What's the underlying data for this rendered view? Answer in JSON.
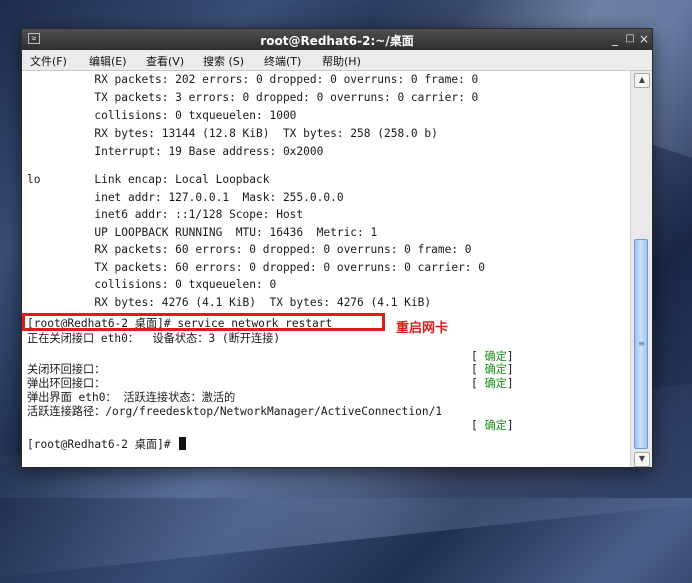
{
  "window": {
    "title": "root@Redhat6-2:~/桌面",
    "icon_glyph": "≥",
    "controls": {
      "minimize": "_",
      "maximize": "□",
      "close": "×"
    }
  },
  "menu": [
    {
      "label": "文件(F)"
    },
    {
      "label": "编辑(E)"
    },
    {
      "label": "查看(V)"
    },
    {
      "label": "搜索 (S)"
    },
    {
      "label": "终端(T)"
    },
    {
      "label": "帮助(H)"
    }
  ],
  "terminal": {
    "lines": [
      "          RX packets: 202 errors: 0 dropped: 0 overruns: 0 frame: 0",
      "          TX packets: 3 errors: 0 dropped: 0 overruns: 0 carrier: 0",
      "          collisions: 0 txqueuelen: 1000",
      "          RX bytes: 13144 (12.8 KiB)  TX bytes: 258 (258.0 b)",
      "          Interrupt: 19 Base address: 0x2000",
      "",
      "lo        Link encap: Local Loopback",
      "          inet addr: 127.0.0.1  Mask: 255.0.0.0",
      "          inet6 addr: ::1/128 Scope: Host",
      "          UP LOOPBACK RUNNING  MTU: 16436  Metric: 1",
      "          RX packets: 60 errors: 0 dropped: 0 overruns: 0 frame: 0",
      "          TX packets: 60 errors: 0 dropped: 0 overruns: 0 carrier: 0",
      "          collisions: 0 txqueuelen: 0",
      "          RX bytes: 4276 (4.1 KiB)  TX bytes: 4276 (4.1 KiB)",
      "",
      "[root@Redhat6-2 桌面]# service network restart",
      "正在关闭接口 eth0：  设备状态：3 (断开连接)",
      "",
      "关闭环回接口：",
      "弹出环回接口：",
      "弹出界面 eth0： 活跃连接状态：激活的",
      "活跃连接路径：/org/freedesktop/NetworkManager/ActiveConnection/1",
      "",
      "[root@Redhat6-2 桌面]# "
    ],
    "ok_marks": [
      "[",
      "确定",
      "]"
    ],
    "annotation": "重启网卡"
  },
  "scrollbar": {
    "up_arrow": "▲",
    "down_arrow": "▼",
    "grip": "≡"
  }
}
